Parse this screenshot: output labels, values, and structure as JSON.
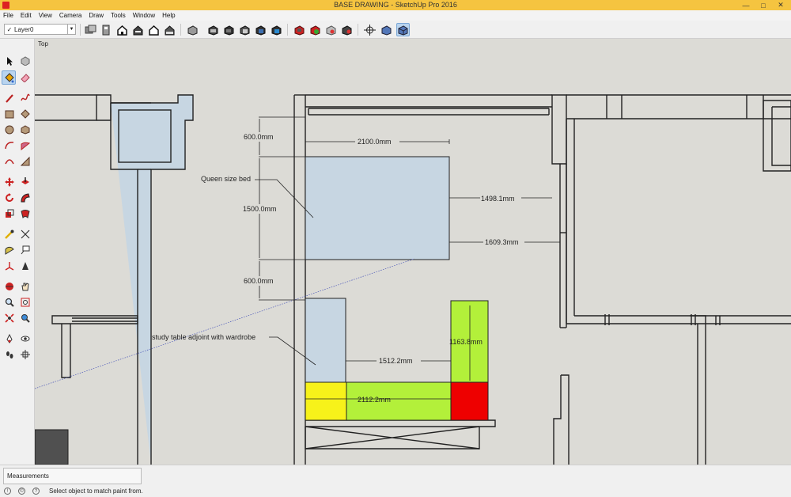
{
  "window": {
    "title": "BASE DRAWING - SketchUp Pro 2016",
    "min_glyph": "—",
    "max_glyph": "□",
    "close_glyph": "✕"
  },
  "menu": [
    "File",
    "Edit",
    "View",
    "Camera",
    "Draw",
    "Tools",
    "Window",
    "Help"
  ],
  "toolbar": {
    "layer_check": "✓",
    "layer": "Layer0",
    "layer_arrow": "▼",
    "icons": [
      "layer-manager-icon",
      "ruler-icon",
      "iso-view-icon",
      "top-view-icon",
      "front-view-icon",
      "right-view-icon",
      "back-view-icon",
      "left-view-icon",
      "xray-style-icon",
      "wireframe-style-icon",
      "hidden-line-style-icon",
      "shaded-style-icon",
      "shaded-textures-style-icon",
      "monochrome-style-icon",
      "3d-warehouse-icon",
      "extension-warehouse-icon",
      "share-model-icon",
      "get-models-icon",
      "orbit-view-icon",
      "perspective-icon",
      "parallel-projection-icon"
    ]
  },
  "left_tools": [
    "select-tool-icon",
    "make-component-icon",
    "paint-bucket-icon",
    "eraser-icon",
    "line-tool-icon",
    "freehand-icon",
    "rectangle-tool-icon",
    "rotated-rectangle-icon",
    "circle-tool-icon",
    "polygon-tool-icon",
    "arc-tool-icon",
    "pie-tool-icon",
    "two-point-arc-icon",
    "three-point-arc-icon",
    "move-tool-icon",
    "push-pull-icon",
    "rotate-tool-icon",
    "follow-me-icon",
    "scale-tool-icon",
    "offset-tool-icon",
    "tape-measure-icon",
    "dimension-tool-icon",
    "protractor-icon",
    "text-tool-icon",
    "axes-tool-icon",
    "3d-text-icon",
    "orbit-tool-icon",
    "pan-tool-icon",
    "zoom-tool-icon",
    "zoom-window-icon",
    "zoom-extents-icon",
    "previous-view-icon",
    "position-camera-icon",
    "look-around-icon",
    "walk-tool-icon",
    "section-plane-icon"
  ],
  "viewport": {
    "scene": "Top",
    "dimensions": {
      "d_600_top": "600.0mm",
      "d_2100": "2100.0mm",
      "d_1498": "1498.1mm",
      "d_1500": "1500.0mm",
      "d_1609": "1609.3mm",
      "d_600_bottom": "600.0mm",
      "d_1512": "1512.2mm",
      "d_1163": "1163.8mm",
      "d_2112": "2112.2mm"
    },
    "labels": {
      "bed": "Queen size bed",
      "study": "study table adjoint with wardrobe"
    },
    "colors": {
      "background": "#dcdbd6",
      "furniture": "#c7d6e2",
      "green": "#b3f03a",
      "yellow": "#f7f21a",
      "red": "#ee0000"
    }
  },
  "status": {
    "measurements_label": "Measurements",
    "message": "Select object to match paint from."
  }
}
